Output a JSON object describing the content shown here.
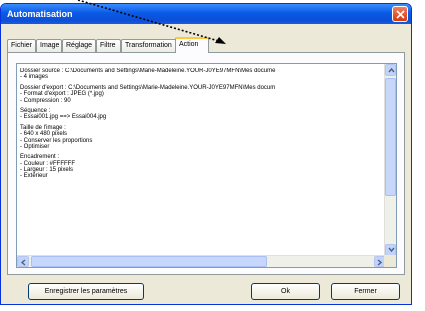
{
  "window": {
    "title": "Automatisation"
  },
  "tabs": [
    {
      "label": "Fichier"
    },
    {
      "label": "Image"
    },
    {
      "label": "Réglage"
    },
    {
      "label": "Filtre"
    },
    {
      "label": "Transformation"
    },
    {
      "label": "Action"
    }
  ],
  "active_tab": "Action",
  "summary": {
    "lines": [
      "Dossier source : C:\\Documents and Settings\\Marie-Madeleine.YOUR-J0YE97MFN\\Mes docume",
      "- 4 images",
      "",
      "Dossier d'export : C:\\Documents and Settings\\Marie-Madeleine.YOUR-J0YE97MFN\\Mes docum",
      "- Format d'export : JPEG (*.jpg)",
      "- Compression : 90",
      "",
      "Séquence :",
      "- Essai001.jpg ==> Essai004.jpg",
      "",
      "Taille de l'image :",
      "- 640 x 480 pixels",
      "- Conserver les proportions",
      "- Optimiser",
      "",
      "Encadrement :",
      "- Couleur : #FFFFFF",
      "- Largeur : 15 pixels",
      "- Extérieur"
    ]
  },
  "buttons": {
    "save_params": "Enregistrer les paramètres",
    "ok": "Ok",
    "close": "Fermer"
  }
}
